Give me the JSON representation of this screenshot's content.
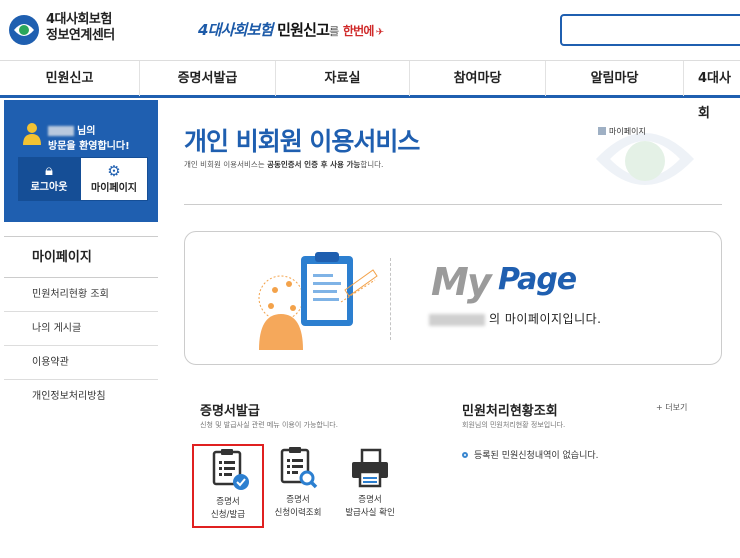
{
  "header": {
    "logo_line1": "4대사회보험",
    "logo_line2": "정보연계센터",
    "slogan_part1": "4대사회보험",
    "slogan_part2": "민원신고",
    "slogan_part3": "를",
    "slogan_part4": "한번에"
  },
  "gnb": {
    "items": [
      "민원신고",
      "증명서발급",
      "자료실",
      "참여마당",
      "알림마당",
      "4대사회"
    ]
  },
  "profile": {
    "welcome_suffix": "님의",
    "welcome_line2": "방문을 환영합니다!",
    "logout_label": "로그아웃",
    "mypage_label": "마이페이지"
  },
  "side_menu": {
    "title": "마이페이지",
    "items": [
      "민원처리현황 조회",
      "나의 게시글",
      "이용약관",
      "개인정보처리방침"
    ]
  },
  "main": {
    "title": "개인 비회원 이용서비스",
    "desc_pre": "개인 비회원 이용서비스는 ",
    "desc_bold": "공동인증서 인증 후 사용 가능",
    "desc_post": "합니다.",
    "breadcrumb": "마이페이지"
  },
  "banner": {
    "my": "My",
    "page": "Page",
    "message": "의 마이페이지입니다."
  },
  "cert_section": {
    "title": "증명서발급",
    "desc": "신청 및 발급사실 관련 메뉴 이용이 가능합니다.",
    "items": [
      {
        "line1": "증명서",
        "line2": "신청/발급"
      },
      {
        "line1": "증명서",
        "line2": "신청이력조회"
      },
      {
        "line1": "증명서",
        "line2": "발급사실 확인"
      }
    ]
  },
  "status_section": {
    "title": "민원처리현황조회",
    "desc": "회원님의 민원처리현황 정보입니다.",
    "more": "+ 더보기",
    "empty": "등록된 민원신청내역이 없습니다."
  },
  "colors": {
    "brand_blue": "#1f5fb0",
    "highlight_red": "#e02020"
  }
}
